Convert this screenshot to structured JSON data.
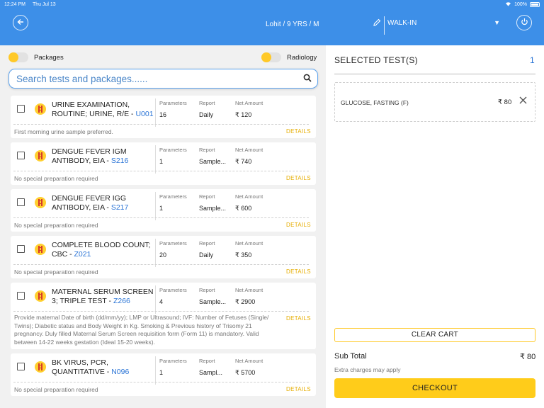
{
  "status": {
    "time": "12:24 PM",
    "date": "Thu Jul 13",
    "battery": "100%"
  },
  "header": {
    "patient": "Lohit / 9 YRS / M",
    "visit_type": "WALK-IN"
  },
  "filters": {
    "packages_label": "Packages",
    "radiology_label": "Radiology"
  },
  "search": {
    "placeholder": "Search tests and packages......"
  },
  "columns": {
    "parameters": "Parameters",
    "report": "Report",
    "net_amount": "Net Amount"
  },
  "details_label": "DETAILS",
  "tests": [
    {
      "name": "URINE EXAMINATION, ROUTINE; URINE, R/E - ",
      "code": "U001",
      "parameters": "16",
      "report": "Daily",
      "amount": "₹ 120",
      "note": "First morning urine sample preferred."
    },
    {
      "name": "DENGUE FEVER IgM ANTIBODY, EIA - ",
      "code": "S216",
      "parameters": "1",
      "report": "Sample...",
      "amount": "₹ 740",
      "note": "No special preparation required"
    },
    {
      "name": "DENGUE FEVER IgG ANTIBODY, EIA - ",
      "code": "S217",
      "parameters": "1",
      "report": "Sample...",
      "amount": "₹ 600",
      "note": "No special preparation required"
    },
    {
      "name": "COMPLETE BLOOD COUNT; CBC - ",
      "code": "Z021",
      "parameters": "20",
      "report": "Daily",
      "amount": "₹ 350",
      "note": "No special preparation required"
    },
    {
      "name": "MATERNAL SERUM SCREEN 3; TRIPLE TEST - ",
      "code": "Z266",
      "parameters": "4",
      "report": "Sample...",
      "amount": "₹ 2900",
      "note": "Provide maternal Date of birth (dd/mm/yy); LMP or Ultrasound; IVF: Number of Fetuses (Single/ Twins); Diabetic status and Body Weight in Kg. Smoking & Previous history of Trisomy 21 pregnancy. Duly filled Maternal Serum Screen requisition  form (Form 11) is mandatory. Valid between 14-22 weeks gestation (Ideal 15-20 weeks)."
    },
    {
      "name": "BK VIRUS, PCR, QUANTITATIVE - ",
      "code": "N096",
      "parameters": "1",
      "report": "Sampl...",
      "amount": "₹ 5700",
      "note": "No special preparation required"
    }
  ],
  "cart": {
    "title": "SELECTED TEST(S)",
    "count": "1",
    "items": [
      {
        "name": "GLUCOSE, FASTING (F)",
        "price": "₹ 80"
      }
    ],
    "clear_label": "CLEAR CART",
    "subtotal_label": "Sub Total",
    "subtotal_value": "₹ 80",
    "extra_note": "Extra charges may apply",
    "checkout_label": "CHECKOUT"
  },
  "icons": {
    "back": "arrow-left-icon",
    "edit": "pencil-icon",
    "power": "power-icon",
    "search": "magnifier-icon",
    "close": "close-icon",
    "dropdown": "chevron-down-icon",
    "test_badge": "test-tube-icon"
  },
  "colors": {
    "primary": "#3d8fe8",
    "accent": "#ffcc1a",
    "link": "#2a74d6"
  }
}
